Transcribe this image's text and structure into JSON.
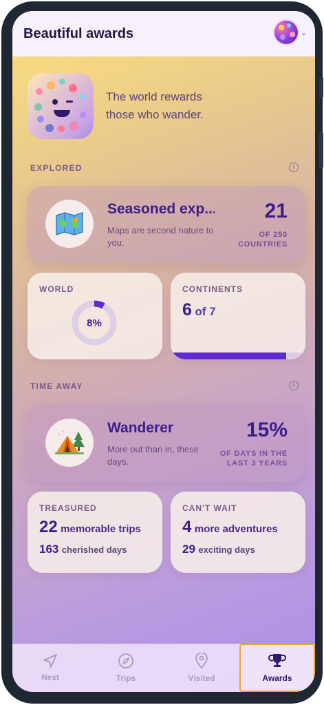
{
  "header": {
    "title": "Beautiful awards",
    "avatar_icon": "profile-avatar",
    "menu_icon": "chevron-down-icon"
  },
  "hero": {
    "tagline": "The world rewards those who wander."
  },
  "explored": {
    "section_label": "EXPLORED",
    "summary": {
      "title": "Seasoned exp...",
      "subtitle": "Maps are second nature to you.",
      "count": "21",
      "count_caption": "OF 250 COUNTRIES",
      "icon": "world-map-icon"
    },
    "world": {
      "label": "WORLD",
      "percent_text": "8%",
      "percent_value": 8
    },
    "continents": {
      "label": "CONTINENTS",
      "count": "6",
      "of_text": "of 7",
      "visited": 6,
      "total": 7
    }
  },
  "time_away": {
    "section_label": "TIME AWAY",
    "summary": {
      "title": "Wanderer",
      "subtitle": "More out than in, these days.",
      "percent": "15%",
      "caption": "OF DAYS IN THE LAST 3 YEARS",
      "icon": "camping-tent-icon"
    },
    "treasured": {
      "label": "TREASURED",
      "trips_count": "22",
      "trips_text": "memorable trips",
      "days_count": "163",
      "days_text": "cherished days"
    },
    "cant_wait": {
      "label": "CAN'T WAIT",
      "adv_count": "4",
      "adv_text": "more adventures",
      "days_count": "29",
      "days_text": "exciting days"
    }
  },
  "nav": {
    "items": [
      {
        "label": "Next",
        "icon": "navigation-arrow-icon"
      },
      {
        "label": "Trips",
        "icon": "compass-icon"
      },
      {
        "label": "Visited",
        "icon": "map-pin-icon"
      },
      {
        "label": "Awards",
        "icon": "trophy-icon",
        "active": true
      }
    ]
  },
  "colors": {
    "accent": "#5f2ad0",
    "text_dark": "#3d1d8a",
    "active_border": "#f0a22a"
  }
}
